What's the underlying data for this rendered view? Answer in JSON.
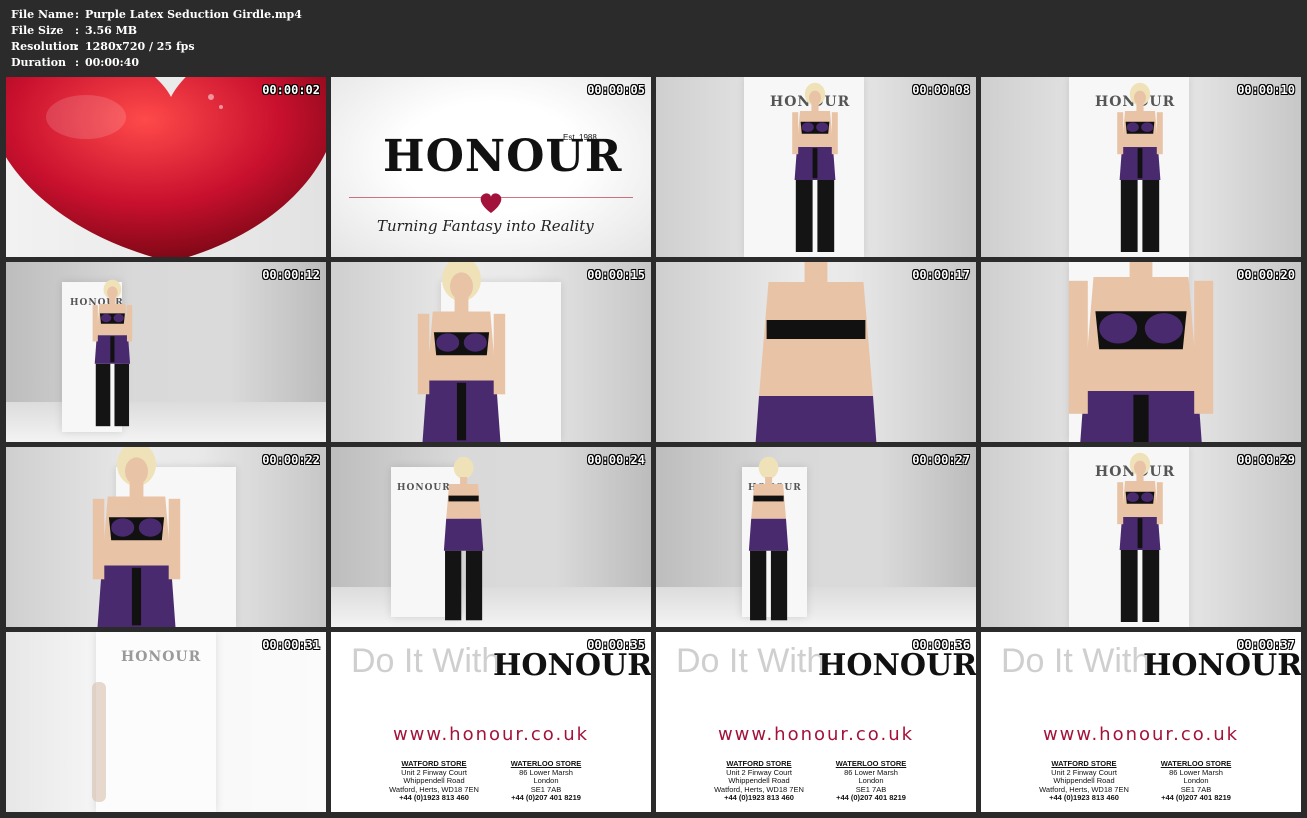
{
  "file_info": {
    "rows": [
      {
        "label": "File Name",
        "sep": ":",
        "value": "Purple Latex Seduction Girdle.mp4"
      },
      {
        "label": "File Size",
        "sep": ":",
        "value": "3.56 MB"
      },
      {
        "label": "Resolution",
        "sep": ":",
        "value": "1280x720 / 25 fps"
      },
      {
        "label": "Duration",
        "sep": ":",
        "value": "00:00:40"
      }
    ]
  },
  "brand": {
    "logo": "HONOUR",
    "est": "Est. 1988",
    "tagline": "Turning Fantasy into Reality",
    "do_it_with": "Do It With",
    "url": "www.honour.co.uk",
    "stores": {
      "watford": {
        "head": "WATFORD STORE",
        "lines": [
          "Unit 2 Finway Court",
          "Whippendell Road",
          "Watford, Herts, WD18 7EN",
          "+44 (0)1923 813 460"
        ]
      },
      "waterloo": {
        "head": "WATERLOO STORE",
        "lines": [
          "86 Lower Marsh",
          "London",
          "SE1 7AB",
          "+44 (0)207 401 8219"
        ]
      }
    },
    "colors": {
      "heart": "#c8102e",
      "url": "#a3123a",
      "latex": "#4a2a6e"
    }
  },
  "thumbnails": [
    {
      "time": "00:00:02",
      "scene": "heart"
    },
    {
      "time": "00:00:05",
      "scene": "logo"
    },
    {
      "time": "00:00:08",
      "scene": "model-front"
    },
    {
      "time": "00:00:10",
      "scene": "model-front"
    },
    {
      "time": "00:00:12",
      "scene": "model-wide"
    },
    {
      "time": "00:00:15",
      "scene": "model-closeup"
    },
    {
      "time": "00:00:17",
      "scene": "model-back-close"
    },
    {
      "time": "00:00:20",
      "scene": "model-torso"
    },
    {
      "time": "00:00:22",
      "scene": "model-closeup"
    },
    {
      "time": "00:00:24",
      "scene": "model-back"
    },
    {
      "time": "00:00:27",
      "scene": "model-back"
    },
    {
      "time": "00:00:29",
      "scene": "model-front"
    },
    {
      "time": "00:00:31",
      "scene": "fade-panel"
    },
    {
      "time": "00:00:35",
      "scene": "end-card"
    },
    {
      "time": "00:00:36",
      "scene": "end-card"
    },
    {
      "time": "00:00:37",
      "scene": "end-card"
    }
  ]
}
